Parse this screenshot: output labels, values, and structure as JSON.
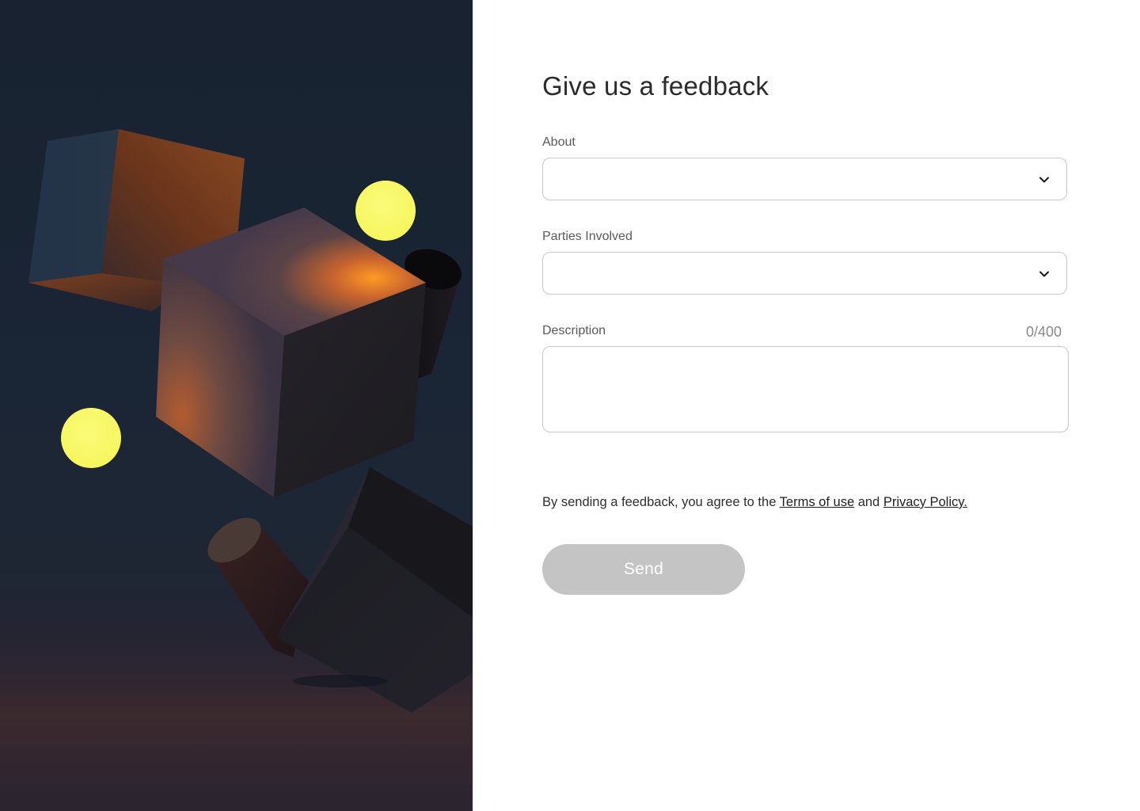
{
  "hero": {
    "icon": "abstract-3d-cubes-illustration"
  },
  "form": {
    "title": "Give us a feedback",
    "about": {
      "label": "About",
      "value": ""
    },
    "parties": {
      "label": "Parties Involved",
      "value": ""
    },
    "description": {
      "label": "Description",
      "counter": "0/400",
      "value": ""
    },
    "agreement": {
      "prefix": "By sending a feedback, you agree to the ",
      "terms_link": "Terms of use",
      "middle": " and ",
      "privacy_link": "Privacy Policy."
    },
    "send_label": "Send"
  },
  "colors": {
    "accent_yellow": "#f8f86a",
    "cube_orange": "#c8642e",
    "panel_dark": "#182230",
    "button_disabled": "#c4c4c4"
  }
}
